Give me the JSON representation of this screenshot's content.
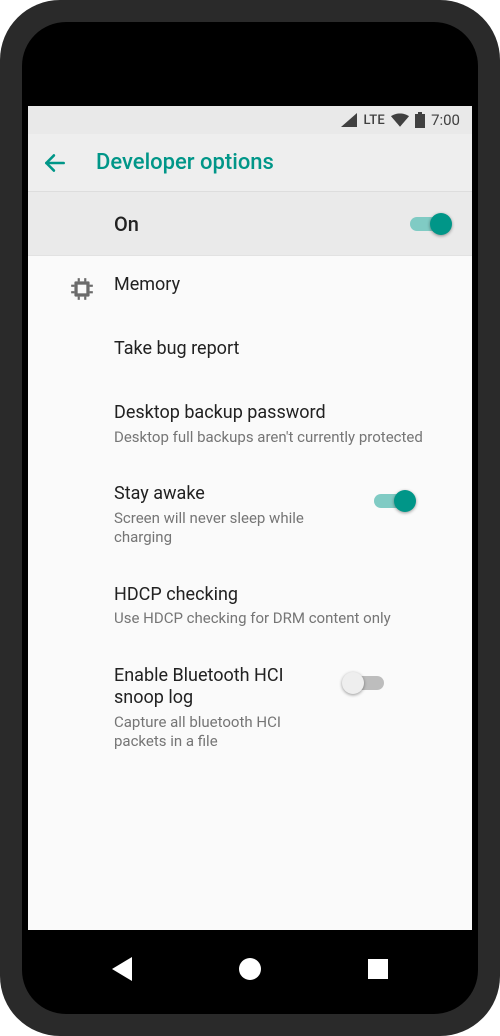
{
  "status": {
    "lte": "LTE",
    "time": "7:00"
  },
  "header": {
    "title": "Developer options"
  },
  "master": {
    "label": "On",
    "on": true
  },
  "items": [
    {
      "title": "Memory",
      "sub": "",
      "icon": "chip",
      "switch": null
    },
    {
      "title": "Take bug report",
      "sub": "",
      "icon": "",
      "switch": null
    },
    {
      "title": "Desktop backup password",
      "sub": "Desktop full backups aren't currently protected",
      "icon": "",
      "switch": null
    },
    {
      "title": "Stay awake",
      "sub": "Screen will never sleep while charging",
      "icon": "",
      "switch": true
    },
    {
      "title": "HDCP checking",
      "sub": "Use HDCP checking for DRM content only",
      "icon": "",
      "switch": null
    },
    {
      "title": "Enable Bluetooth HCI snoop log",
      "sub": "Capture all bluetooth HCI packets in a file",
      "icon": "",
      "switch": false
    }
  ],
  "colors": {
    "accent": "#009688"
  }
}
